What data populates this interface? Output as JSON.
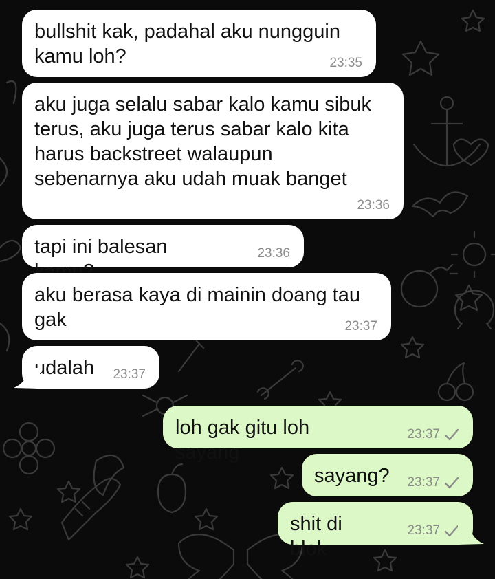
{
  "messages": [
    {
      "id": "m1",
      "direction": "incoming",
      "text": "bullshit kak, padahal aku nungguin\nkamu loh?",
      "time": "23:35"
    },
    {
      "id": "m2",
      "direction": "incoming",
      "text": "aku juga selalu sabar kalo kamu sibuk\nterus, aku juga terus sabar kalo kita\nharus backstreet walaupun\nsebenarnya aku udah muak banget",
      "time": "23:36"
    },
    {
      "id": "m3",
      "direction": "incoming",
      "text": "tapi ini balesan kamu?",
      "time": "23:36"
    },
    {
      "id": "m4",
      "direction": "incoming",
      "text": "aku berasa kaya di mainin doang tau\ngak",
      "time": "23:37"
    },
    {
      "id": "m5",
      "direction": "incoming",
      "text": "udalah",
      "time": "23:37"
    },
    {
      "id": "m6",
      "direction": "outgoing",
      "text": "loh gak gitu loh sayang",
      "time": "23:37",
      "status": "sent-check-icon"
    },
    {
      "id": "m7",
      "direction": "outgoing",
      "text": "sayang?",
      "time": "23:37",
      "status": "sent-check-icon"
    },
    {
      "id": "m8",
      "direction": "outgoing",
      "text": "shit di blok",
      "time": "23:37",
      "status": "sent-check-icon"
    }
  ],
  "colors": {
    "background": "#0b0b0b",
    "wallpaper_doodle": "#3a3a3a",
    "incoming_bubble": "#ffffff",
    "outgoing_bubble": "#dcf8c6",
    "timestamp": "#8c8c8c"
  }
}
